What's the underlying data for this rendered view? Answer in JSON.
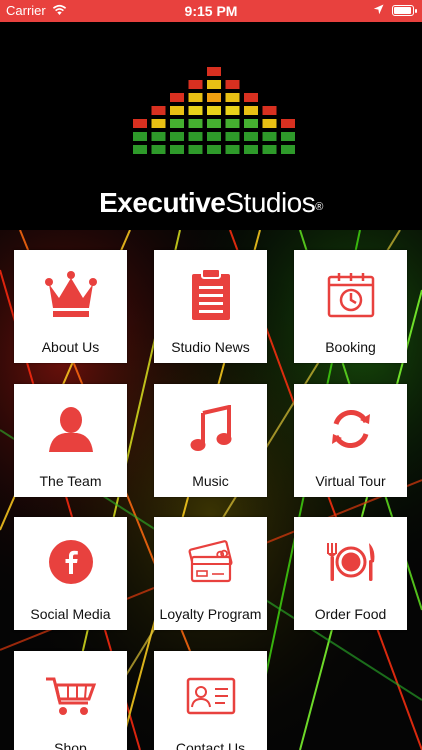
{
  "status_bar": {
    "carrier": "Carrier",
    "time": "9:15 PM",
    "battery_level": 0.95
  },
  "header": {
    "brand_bold": "Executive",
    "brand_regular": "Studios",
    "registered_mark": "®"
  },
  "tiles": [
    {
      "label": "About Us",
      "icon": "crown-icon"
    },
    {
      "label": "Studio News",
      "icon": "clipboard-icon"
    },
    {
      "label": "Booking",
      "icon": "calendar-clock-icon"
    },
    {
      "label": "The Team",
      "icon": "person-icon"
    },
    {
      "label": "Music",
      "icon": "music-note-icon"
    },
    {
      "label": "Virtual Tour",
      "icon": "refresh-icon"
    },
    {
      "label": "Social Media",
      "icon": "facebook-icon"
    },
    {
      "label": "Loyalty Program",
      "icon": "cards-icon"
    },
    {
      "label": "Order Food",
      "icon": "plate-cutlery-icon"
    },
    {
      "label": "Shop",
      "icon": "cart-icon"
    },
    {
      "label": "Contact Us",
      "icon": "contact-card-icon"
    }
  ],
  "colors": {
    "accent": "#e8413e",
    "icon": "#e8413e",
    "tile_bg": "#ffffff",
    "header_bg": "#000000"
  }
}
